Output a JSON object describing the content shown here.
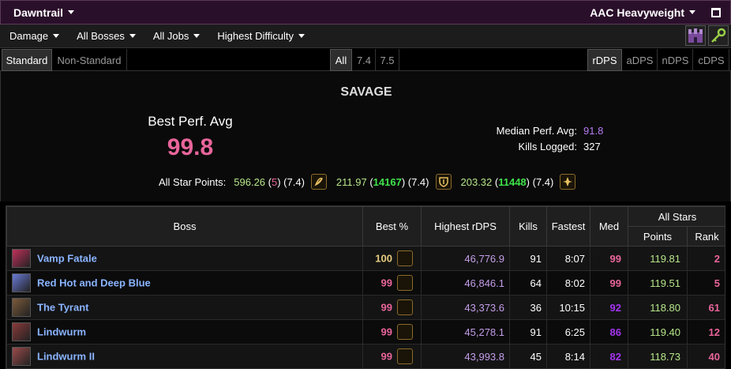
{
  "topbar": {
    "expansion": "Dawntrail",
    "division": "AAC Heavyweight"
  },
  "filters": [
    "Damage",
    "All Bosses",
    "All Jobs",
    "Highest Difficulty"
  ],
  "tabs": {
    "standard": "Standard",
    "nonstandard": "Non-Standard",
    "all": "All",
    "v74": "7.4",
    "v75": "7.5",
    "rdps": "rDPS",
    "adps": "aDPS",
    "ndps": "nDPS",
    "cdps": "cDPS"
  },
  "summary": {
    "difficulty": "SAVAGE",
    "best_perf_label": "Best Perf. Avg",
    "best_perf_value": "99.8",
    "median_label": "Median Perf. Avg:",
    "median_value": "91.8",
    "kills_label": "Kills Logged:",
    "kills_value": "327",
    "stars_label": "All Star Points:",
    "stars": [
      {
        "points": "596.26",
        "rank": "5",
        "patch": "(7.4)",
        "icon": "bard-icon"
      },
      {
        "points": "211.97",
        "rank": "14167",
        "patch": "(7.4)",
        "icon": "paladin-icon"
      },
      {
        "points": "203.32",
        "rank": "11448",
        "patch": "(7.4)",
        "icon": "white-mage-icon"
      }
    ]
  },
  "table": {
    "headers": {
      "boss": "Boss",
      "best": "Best %",
      "highest": "Highest rDPS",
      "kills": "Kills",
      "fastest": "Fastest",
      "med": "Med",
      "allstars": "All Stars",
      "points": "Points",
      "rank": "Rank"
    },
    "rows": [
      {
        "boss": "Vamp Fatale",
        "best": "100",
        "dps": "46,776.9",
        "kills": "91",
        "fastest": "8:07",
        "med": "99",
        "points": "119.81",
        "rank": "2",
        "icon_color": "#c0305a"
      },
      {
        "boss": "Red Hot and Deep Blue",
        "best": "99",
        "dps": "46,846.1",
        "kills": "64",
        "fastest": "8:02",
        "med": "99",
        "points": "119.51",
        "rank": "5",
        "icon_color": "#6a7ad8"
      },
      {
        "boss": "The Tyrant",
        "best": "99",
        "dps": "43,373.6",
        "kills": "36",
        "fastest": "10:15",
        "med": "92",
        "points": "118.80",
        "rank": "61",
        "icon_color": "#7a5a3a"
      },
      {
        "boss": "Lindwurm",
        "best": "99",
        "dps": "45,278.1",
        "kills": "91",
        "fastest": "6:25",
        "med": "86",
        "points": "119.40",
        "rank": "12",
        "icon_color": "#8a3a3a"
      },
      {
        "boss": "Lindwurm II",
        "best": "99",
        "dps": "43,993.8",
        "kills": "45",
        "fastest": "8:14",
        "med": "82",
        "points": "118.73",
        "rank": "40",
        "icon_color": "#9a4a4a"
      }
    ]
  }
}
